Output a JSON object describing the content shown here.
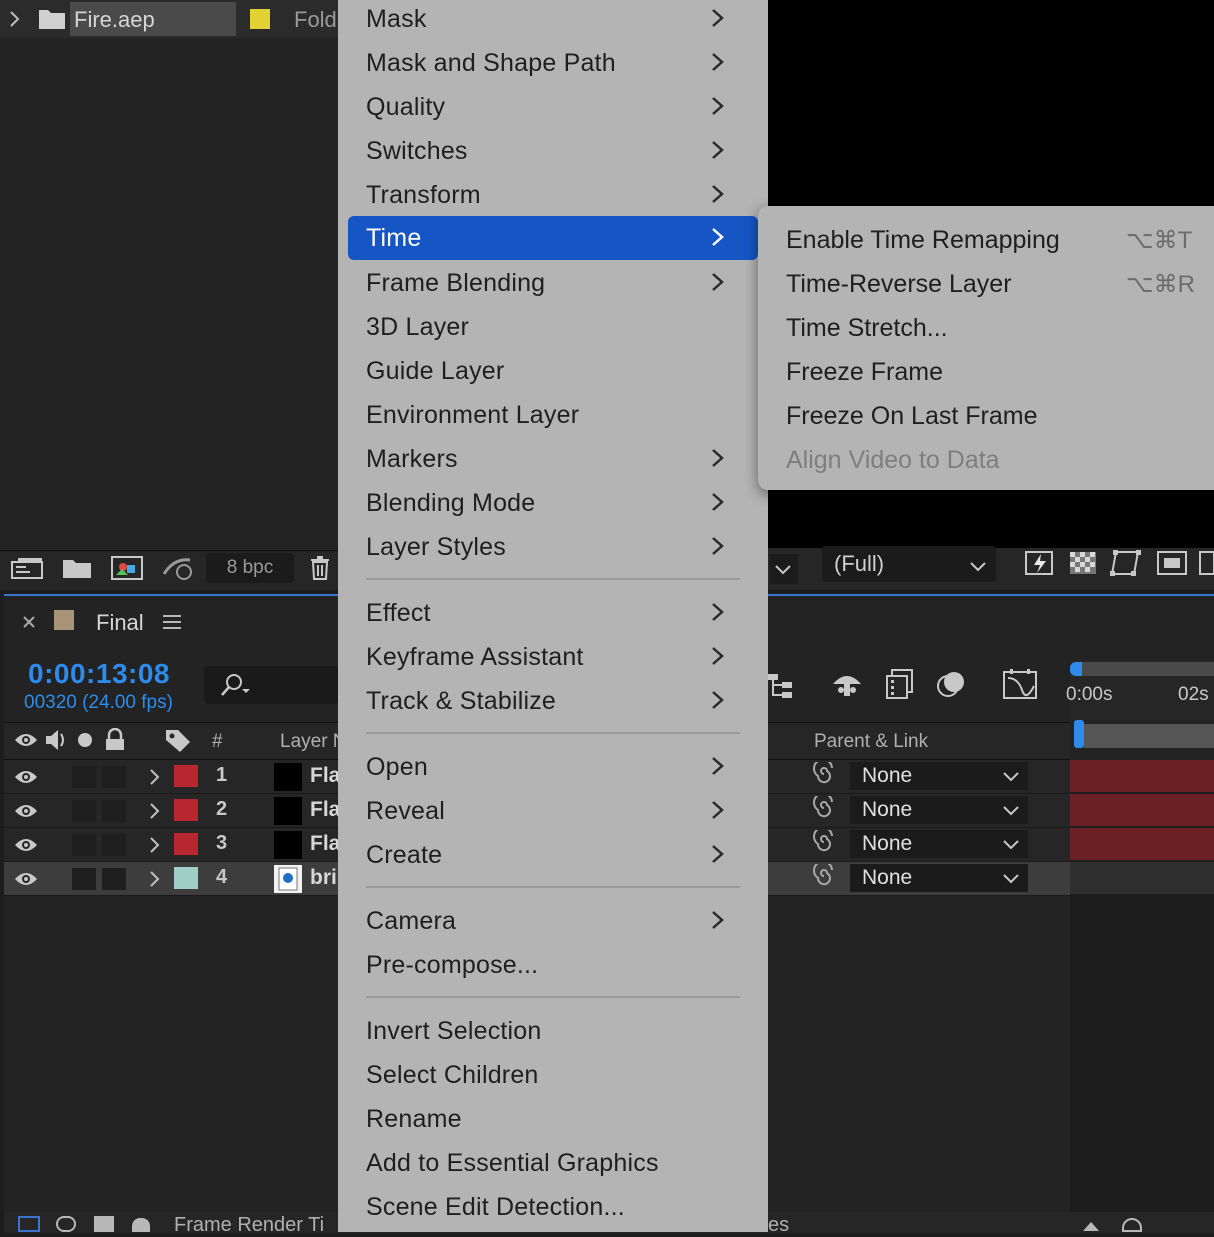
{
  "project_panel": {
    "file_name": "Fire.aep",
    "folder_label": "Fold",
    "bpc": "8 bpc"
  },
  "viewer": {
    "resolution": "(Full)"
  },
  "timeline": {
    "comp_name": "Final",
    "timecode": "0:00:13:08",
    "frames": "00320 (24.00 fps)",
    "col_hash": "#",
    "col_layer_name": "Layer N",
    "col_parent": "Parent & Link",
    "ruler": [
      "0:00s",
      "02s"
    ],
    "layers": [
      {
        "num": "1",
        "name": "Fla",
        "label_color": "#b8262f",
        "parent": "None"
      },
      {
        "num": "2",
        "name": "Fla",
        "label_color": "#b8262f",
        "parent": "None"
      },
      {
        "num": "3",
        "name": "Fla",
        "label_color": "#b8262f",
        "parent": "None"
      },
      {
        "num": "4",
        "name": "bri",
        "label_color": "#9fcfc6",
        "parent": "None"
      }
    ],
    "bottom_text": "Frame Render Ti",
    "bottom_text_right": "es"
  },
  "context_menu": {
    "items": [
      {
        "label": "Mask",
        "submenu": true
      },
      {
        "label": "Mask and Shape Path",
        "submenu": true
      },
      {
        "label": "Quality",
        "submenu": true
      },
      {
        "label": "Switches",
        "submenu": true
      },
      {
        "label": "Transform",
        "submenu": true
      },
      {
        "label": "Time",
        "submenu": true,
        "highlighted": true
      },
      {
        "label": "Frame Blending",
        "submenu": true
      },
      {
        "label": "3D Layer",
        "submenu": false
      },
      {
        "label": "Guide Layer",
        "submenu": false
      },
      {
        "label": "Environment Layer",
        "submenu": false
      },
      {
        "label": "Markers",
        "submenu": true
      },
      {
        "label": "Blending Mode",
        "submenu": true
      },
      {
        "label": "Layer Styles",
        "submenu": true
      },
      {
        "label": "Effect",
        "submenu": true
      },
      {
        "label": "Keyframe Assistant",
        "submenu": true
      },
      {
        "label": "Track & Stabilize",
        "submenu": true
      },
      {
        "label": "Open",
        "submenu": true
      },
      {
        "label": "Reveal",
        "submenu": true
      },
      {
        "label": "Create",
        "submenu": true
      },
      {
        "label": "Camera",
        "submenu": true
      },
      {
        "label": "Pre-compose...",
        "submenu": false
      },
      {
        "label": "Invert Selection",
        "submenu": false
      },
      {
        "label": "Select Children",
        "submenu": false
      },
      {
        "label": "Rename",
        "submenu": false
      },
      {
        "label": "Add to Essential Graphics",
        "submenu": false
      },
      {
        "label": "Scene Edit Detection...",
        "submenu": false
      }
    ]
  },
  "time_submenu": {
    "items": [
      {
        "label": "Enable Time Remapping",
        "shortcut": "⌥⌘T",
        "enabled": true
      },
      {
        "label": "Time-Reverse Layer",
        "shortcut": "⌥⌘R",
        "enabled": true
      },
      {
        "label": "Time Stretch...",
        "shortcut": "",
        "enabled": true
      },
      {
        "label": "Freeze Frame",
        "shortcut": "",
        "enabled": true
      },
      {
        "label": "Freeze On Last Frame",
        "shortcut": "",
        "enabled": true
      },
      {
        "label": "Align Video to Data",
        "shortcut": "",
        "enabled": false
      }
    ]
  },
  "colors": {
    "accent": "#1656c4",
    "timecode": "#2d8ceb",
    "menu_bg": "#b4b4b4",
    "track_bar": "#6a2024"
  }
}
